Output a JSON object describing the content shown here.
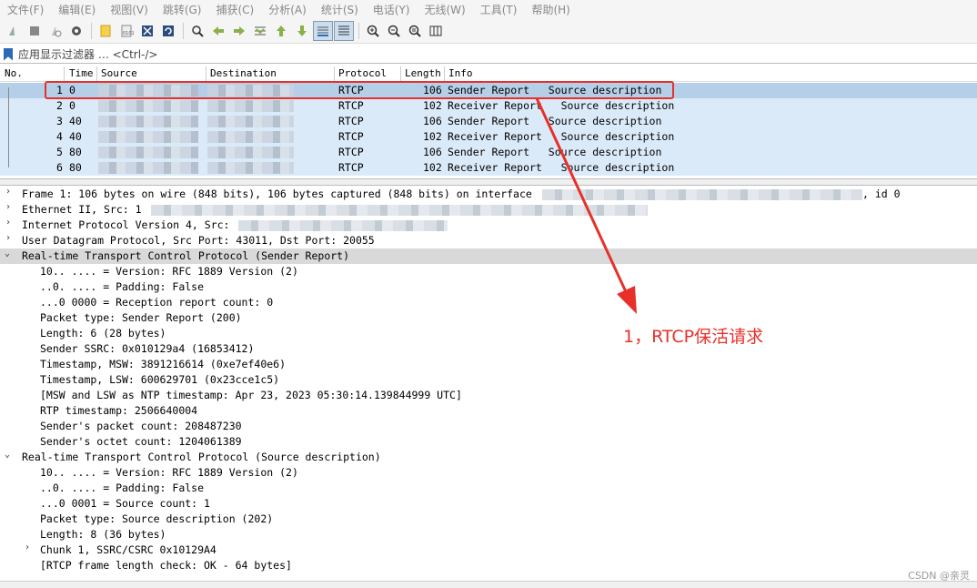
{
  "menu": [
    "文件(F)",
    "编辑(E)",
    "视图(V)",
    "跳转(G)",
    "捕获(C)",
    "分析(A)",
    "统计(S)",
    "电话(Y)",
    "无线(W)",
    "工具(T)",
    "帮助(H)"
  ],
  "toolbar_icons": [
    "shark-fin-start-icon",
    "stop-icon",
    "restart-icon",
    "options-gear-icon",
    "open-file-icon",
    "save-file-icon",
    "close-file-icon",
    "reload-icon",
    "find-icon",
    "go-back-icon",
    "go-forward-icon",
    "go-to-packet-icon",
    "go-first-icon",
    "go-last-icon",
    "autoscroll-icon",
    "colorize-icon",
    "zoom-in-icon",
    "zoom-out-icon",
    "zoom-normal-icon",
    "resize-columns-icon"
  ],
  "filter": {
    "placeholder": "应用显示过滤器 … <Ctrl-/>"
  },
  "columns": [
    "No.",
    "Time",
    "Source",
    "Destination",
    "Protocol",
    "Length",
    "Info"
  ],
  "packets": [
    {
      "no": "1",
      "time": "0",
      "protocol": "RTCP",
      "length": "106",
      "info": "Sender Report   Source description"
    },
    {
      "no": "2",
      "time": "0",
      "protocol": "RTCP",
      "length": "102",
      "info": "Receiver Report   Source description"
    },
    {
      "no": "3",
      "time": "40",
      "protocol": "RTCP",
      "length": "106",
      "info": "Sender Report   Source description"
    },
    {
      "no": "4",
      "time": "40",
      "protocol": "RTCP",
      "length": "102",
      "info": "Receiver Report   Source description"
    },
    {
      "no": "5",
      "time": "80",
      "protocol": "RTCP",
      "length": "106",
      "info": "Sender Report   Source description"
    },
    {
      "no": "6",
      "time": "80",
      "protocol": "RTCP",
      "length": "102",
      "info": "Receiver Report   Source description"
    }
  ],
  "details": {
    "frame": "Frame 1: 106 bytes on wire (848 bits), 106 bytes captured (848 bits) on interface",
    "frame_suffix": ", id 0",
    "ethernet": "Ethernet II, Src: 1",
    "ip": "Internet Protocol Version 4, Src:",
    "udp": "User Datagram Protocol, Src Port: 43011, Dst Port: 20055",
    "rtcp_sr_header": "Real-time Transport Control Protocol (Sender Report)",
    "rtcp_sr_fields": [
      "10.. .... = Version: RFC 1889 Version (2)",
      "..0. .... = Padding: False",
      "...0 0000 = Reception report count: 0",
      "Packet type: Sender Report (200)",
      "Length: 6 (28 bytes)",
      "Sender SSRC: 0x010129a4 (16853412)",
      "Timestamp, MSW: 3891216614 (0xe7ef40e6)",
      "Timestamp, LSW: 600629701 (0x23cce1c5)",
      "[MSW and LSW as NTP timestamp: Apr 23, 2023 05:30:14.139844999 UTC]",
      "RTP timestamp: 2506640004",
      "Sender's packet count: 208487230",
      "Sender's octet count: 1204061389"
    ],
    "rtcp_sd_header": "Real-time Transport Control Protocol (Source description)",
    "rtcp_sd_fields": [
      "10.. .... = Version: RFC 1889 Version (2)",
      "..0. .... = Padding: False",
      "...0 0001 = Source count: 1",
      "Packet type: Source description (202)",
      "Length: 8 (36 bytes)"
    ],
    "chunk": "Chunk 1, SSRC/CSRC 0x10129A4",
    "length_check": "[RTCP frame length check: OK - 64 bytes]"
  },
  "annotation": "1，RTCP保活请求",
  "watermark": "CSDN @亲灵",
  "colors": {
    "annotation": "#e8302a",
    "row_bg": "#dbeaf9",
    "row_selected": "#b6cfe8"
  }
}
